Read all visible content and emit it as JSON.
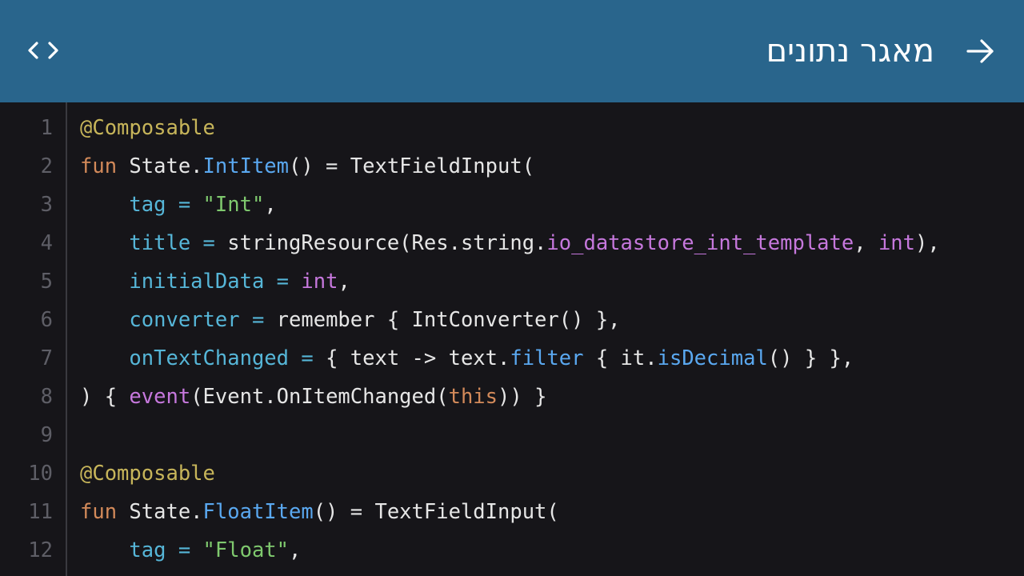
{
  "header": {
    "title": "מאגר נתונים",
    "left_icon": "code-brackets-icon",
    "right_icon": "arrow-right-icon"
  },
  "colors": {
    "header_bg": "#29658c",
    "editor_bg": "#161519",
    "default": "#e6e6e6",
    "annotation": "#c7b55a",
    "keyword": "#d38a5a",
    "function": "#5aa8f0",
    "string": "#7fc96e",
    "param": "#56b6d8",
    "member": "#c678dd",
    "line_number": "#5e5e66"
  },
  "code": {
    "lines": [
      {
        "number": "1",
        "tokens": [
          {
            "t": "@Composable",
            "c": "annotation"
          }
        ]
      },
      {
        "number": "2",
        "tokens": [
          {
            "t": "fun",
            "c": "keyword"
          },
          {
            "t": " State.",
            "c": "default"
          },
          {
            "t": "IntItem",
            "c": "function"
          },
          {
            "t": "() = TextFieldInput(",
            "c": "default"
          }
        ]
      },
      {
        "number": "3",
        "tokens": [
          {
            "t": "    ",
            "c": "default"
          },
          {
            "t": "tag",
            "c": "param"
          },
          {
            "t": " = ",
            "c": "param"
          },
          {
            "t": "\"Int\"",
            "c": "string"
          },
          {
            "t": ",",
            "c": "default"
          }
        ]
      },
      {
        "number": "4",
        "tokens": [
          {
            "t": "    ",
            "c": "default"
          },
          {
            "t": "title",
            "c": "param"
          },
          {
            "t": " = ",
            "c": "param"
          },
          {
            "t": "stringResource(Res.string.",
            "c": "default"
          },
          {
            "t": "io_datastore_int_template",
            "c": "member"
          },
          {
            "t": ", ",
            "c": "default"
          },
          {
            "t": "int",
            "c": "member"
          },
          {
            "t": "),",
            "c": "default"
          }
        ]
      },
      {
        "number": "5",
        "tokens": [
          {
            "t": "    ",
            "c": "default"
          },
          {
            "t": "initialData",
            "c": "param"
          },
          {
            "t": " = ",
            "c": "param"
          },
          {
            "t": "int",
            "c": "member"
          },
          {
            "t": ",",
            "c": "default"
          }
        ]
      },
      {
        "number": "6",
        "tokens": [
          {
            "t": "    ",
            "c": "default"
          },
          {
            "t": "converter",
            "c": "param"
          },
          {
            "t": " = ",
            "c": "param"
          },
          {
            "t": "remember { IntConverter() },",
            "c": "default"
          }
        ]
      },
      {
        "number": "7",
        "tokens": [
          {
            "t": "    ",
            "c": "default"
          },
          {
            "t": "onTextChanged",
            "c": "param"
          },
          {
            "t": " = ",
            "c": "param"
          },
          {
            "t": "{ text -> text.",
            "c": "default"
          },
          {
            "t": "filter",
            "c": "function"
          },
          {
            "t": " { it.",
            "c": "default"
          },
          {
            "t": "isDecimal",
            "c": "function"
          },
          {
            "t": "() } },",
            "c": "default"
          }
        ]
      },
      {
        "number": "8",
        "tokens": [
          {
            "t": ") { ",
            "c": "default"
          },
          {
            "t": "event",
            "c": "member"
          },
          {
            "t": "(Event.OnItemChanged(",
            "c": "default"
          },
          {
            "t": "this",
            "c": "keyword"
          },
          {
            "t": ")) }",
            "c": "default"
          }
        ]
      },
      {
        "number": "9",
        "tokens": []
      },
      {
        "number": "10",
        "tokens": [
          {
            "t": "@Composable",
            "c": "annotation"
          }
        ]
      },
      {
        "number": "11",
        "tokens": [
          {
            "t": "fun",
            "c": "keyword"
          },
          {
            "t": " State.",
            "c": "default"
          },
          {
            "t": "FloatItem",
            "c": "function"
          },
          {
            "t": "() = TextFieldInput(",
            "c": "default"
          }
        ]
      },
      {
        "number": "12",
        "tokens": [
          {
            "t": "    ",
            "c": "default"
          },
          {
            "t": "tag",
            "c": "param"
          },
          {
            "t": " = ",
            "c": "param"
          },
          {
            "t": "\"Float\"",
            "c": "string"
          },
          {
            "t": ",",
            "c": "default"
          }
        ]
      }
    ]
  }
}
